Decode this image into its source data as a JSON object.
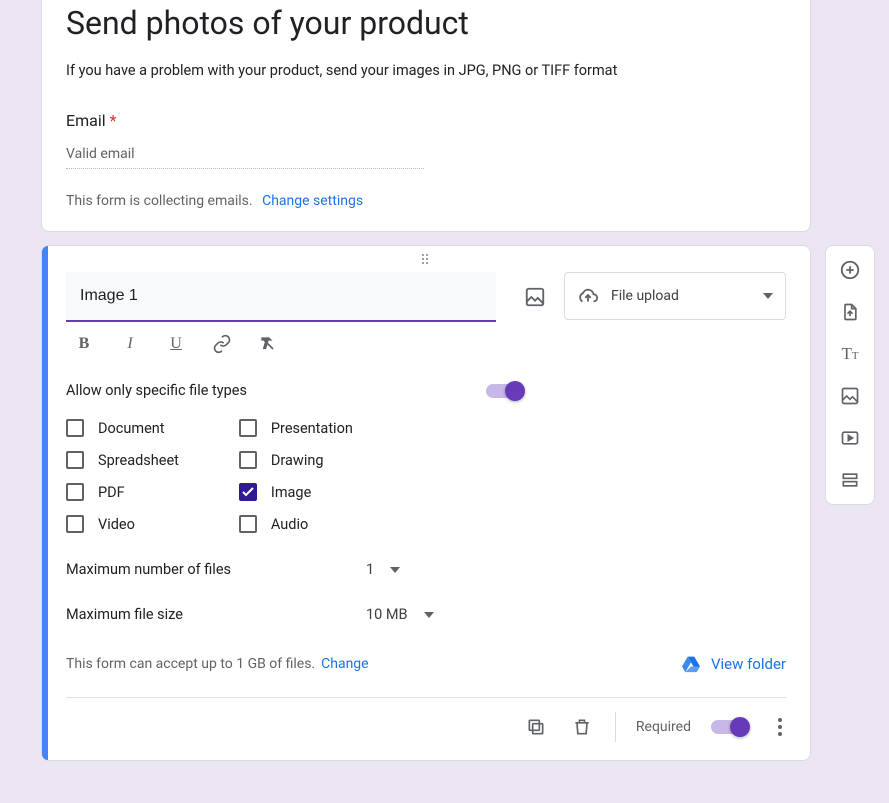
{
  "header": {
    "title": "Send photos of your product",
    "description": "If you have a problem with your product, send your images in JPG, PNG or TIFF format",
    "email_label": "Email",
    "email_placeholder": "Valid email",
    "collecting_text": "This form is collecting emails.",
    "change_settings": "Change settings"
  },
  "question": {
    "title_value": "Image 1",
    "type_label": "File upload",
    "allow_specific_label": "Allow only specific file types",
    "allow_specific_on": true,
    "filetypes_col1": [
      {
        "label": "Document",
        "checked": false
      },
      {
        "label": "Spreadsheet",
        "checked": false
      },
      {
        "label": "PDF",
        "checked": false
      },
      {
        "label": "Video",
        "checked": false
      }
    ],
    "filetypes_col2": [
      {
        "label": "Presentation",
        "checked": false
      },
      {
        "label": "Drawing",
        "checked": false
      },
      {
        "label": "Image",
        "checked": true
      },
      {
        "label": "Audio",
        "checked": false
      }
    ],
    "max_files_label": "Maximum number of files",
    "max_files_value": "1",
    "max_size_label": "Maximum file size",
    "max_size_value": "10 MB",
    "limit_text": "This form can accept up to 1 GB of files.",
    "limit_change": "Change",
    "view_folder": "View folder",
    "required_label": "Required",
    "required_on": true
  }
}
